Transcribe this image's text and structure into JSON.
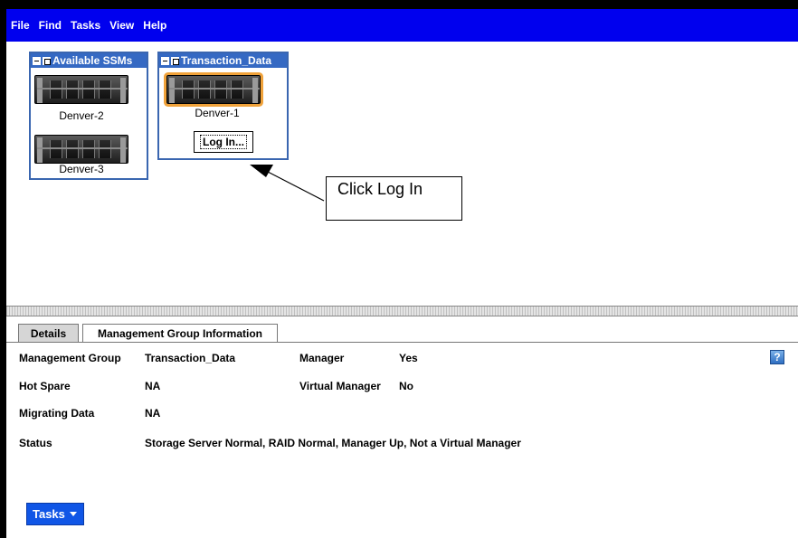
{
  "menu": {
    "items": [
      {
        "label": "File"
      },
      {
        "label": "Find"
      },
      {
        "label": "Tasks"
      },
      {
        "label": "View"
      },
      {
        "label": "Help"
      }
    ]
  },
  "groups": {
    "available": {
      "title": "Available SSMs",
      "servers": [
        {
          "name": "Denver-2"
        },
        {
          "name": "Denver-3"
        }
      ]
    },
    "transaction": {
      "title": "Transaction_Data",
      "servers": [
        {
          "name": "Denver-1"
        }
      ],
      "login_label": "Log In..."
    }
  },
  "callout": {
    "text": "Click Log In"
  },
  "details": {
    "tabs": [
      {
        "label": "Details"
      },
      {
        "label": "Management Group Information"
      }
    ],
    "rows": {
      "management_group_label": "Management Group",
      "management_group_value": "Transaction_Data",
      "manager_label": "Manager",
      "manager_value": "Yes",
      "hot_spare_label": "Hot Spare",
      "hot_spare_value": "NA",
      "virtual_manager_label": "Virtual Manager",
      "virtual_manager_value": "No",
      "migrating_data_label": "Migrating Data",
      "migrating_data_value": "NA",
      "status_label": "Status",
      "status_value": "Storage Server Normal,  RAID Normal, Manager Up, Not a Virtual Manager"
    },
    "help_glyph": "?",
    "tasks_label": "Tasks"
  },
  "colors": {
    "menubar": "#0000ee",
    "group_header": "#3569c3",
    "selection": "#f0a23a",
    "tasks_button": "#1056e6"
  },
  "icons": [
    "collapse-icon",
    "group-checkbox-icon",
    "server-icon",
    "help-icon",
    "dropdown-caret-icon",
    "arrow-icon"
  ]
}
